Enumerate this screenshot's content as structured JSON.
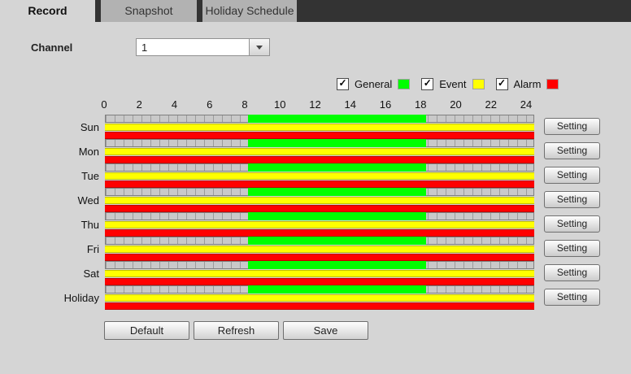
{
  "tabs": [
    {
      "label": "Record",
      "active": true
    },
    {
      "label": "Snapshot",
      "active": false
    },
    {
      "label": "Holiday Schedule",
      "active": false
    }
  ],
  "channel": {
    "label": "Channel",
    "value": "1"
  },
  "legend": [
    {
      "label": "General",
      "checked": true
    },
    {
      "label": "Event",
      "checked": true
    },
    {
      "label": "Alarm",
      "checked": true
    }
  ],
  "colors": {
    "general": "#00ff00",
    "event": "#ffff00",
    "alarm": "#ff0000",
    "tab_strip_dark": "#333333",
    "page_background": "#d5d5d5"
  },
  "glyphs": {
    "check": "✓"
  },
  "timeline": {
    "axis_ticks": [
      0,
      2,
      4,
      6,
      8,
      10,
      12,
      14,
      16,
      18,
      20,
      22,
      24
    ],
    "hours_total": 24,
    "rows": [
      {
        "day": "Sun",
        "general": {
          "start": 8,
          "end": 18
        },
        "event": {
          "start": 0,
          "end": 24
        },
        "alarm": {
          "start": 0,
          "end": 24
        },
        "setting_label": "Setting"
      },
      {
        "day": "Mon",
        "general": {
          "start": 8,
          "end": 18
        },
        "event": {
          "start": 0,
          "end": 24
        },
        "alarm": {
          "start": 0,
          "end": 24
        },
        "setting_label": "Setting"
      },
      {
        "day": "Tue",
        "general": {
          "start": 8,
          "end": 18
        },
        "event": {
          "start": 0,
          "end": 24
        },
        "alarm": {
          "start": 0,
          "end": 24
        },
        "setting_label": "Setting"
      },
      {
        "day": "Wed",
        "general": {
          "start": 8,
          "end": 18
        },
        "event": {
          "start": 0,
          "end": 24
        },
        "alarm": {
          "start": 0,
          "end": 24
        },
        "setting_label": "Setting"
      },
      {
        "day": "Thu",
        "general": {
          "start": 8,
          "end": 18
        },
        "event": {
          "start": 0,
          "end": 24
        },
        "alarm": {
          "start": 0,
          "end": 24
        },
        "setting_label": "Setting"
      },
      {
        "day": "Fri",
        "general": {
          "start": 8,
          "end": 18
        },
        "event": {
          "start": 0,
          "end": 24
        },
        "alarm": {
          "start": 0,
          "end": 24
        },
        "setting_label": "Setting"
      },
      {
        "day": "Sat",
        "general": {
          "start": 8,
          "end": 18
        },
        "event": {
          "start": 0,
          "end": 24
        },
        "alarm": {
          "start": 0,
          "end": 24
        },
        "setting_label": "Setting"
      },
      {
        "day": "Holiday",
        "general": {
          "start": 8,
          "end": 18
        },
        "event": {
          "start": 0,
          "end": 24
        },
        "alarm": {
          "start": 0,
          "end": 24
        },
        "setting_label": "Setting"
      }
    ]
  },
  "footer_buttons": [
    "Default",
    "Refresh",
    "Save"
  ]
}
